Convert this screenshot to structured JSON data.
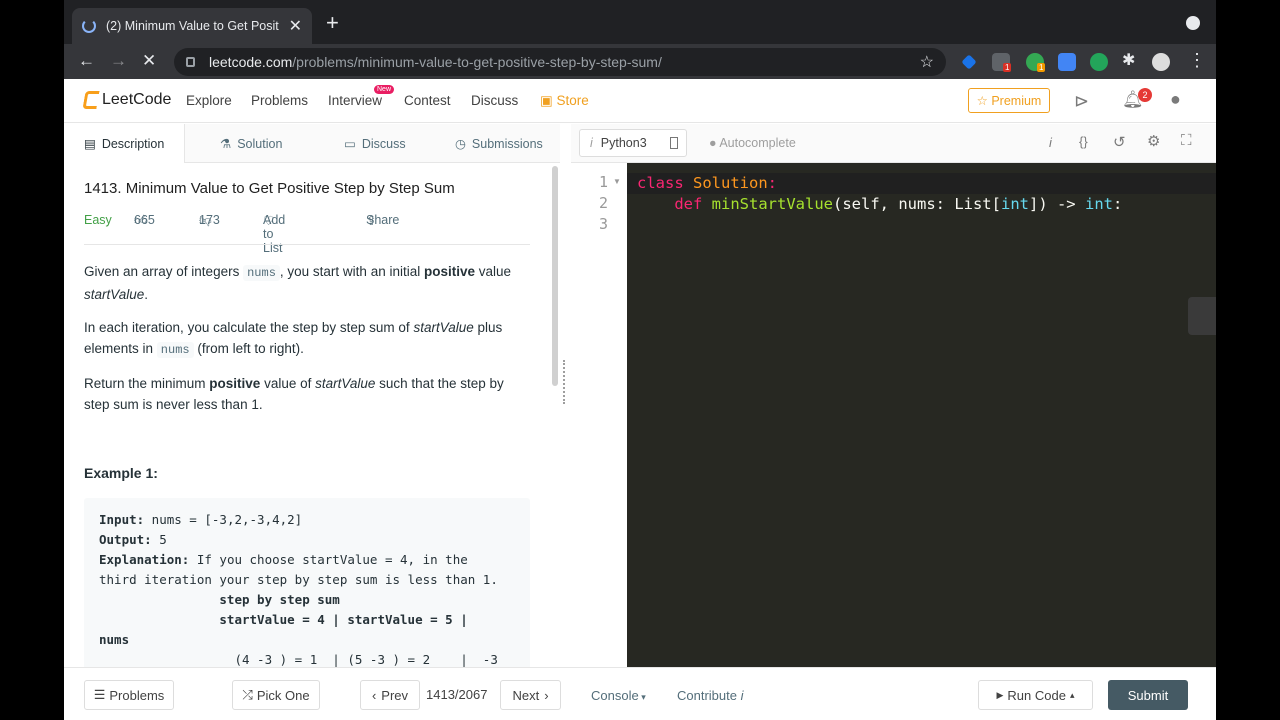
{
  "browser": {
    "tab_title": "(2) Minimum Value to Get Posit",
    "url_domain": "leetcode.com",
    "url_path": "/problems/minimum-value-to-get-positive-step-by-step-sum/",
    "ext_badge_red": "1",
    "ext_badge_orange": "1"
  },
  "nav": {
    "logo": "LeetCode",
    "explore": "Explore",
    "problems": "Problems",
    "interview": "Interview",
    "new_badge": "New",
    "contest": "Contest",
    "discuss": "Discuss",
    "store": "Store",
    "premium": "☆ Premium",
    "notif_count": "2"
  },
  "left_tabs": {
    "description": "Description",
    "solution": "Solution",
    "discuss": "Discuss",
    "submissions": "Submissions"
  },
  "problem": {
    "title": "1413. Minimum Value to Get Positive Step by Step Sum",
    "difficulty": "Easy",
    "likes": "665",
    "dislikes": "173",
    "add_to_list": "Add to List",
    "share": "Share",
    "p1a": "Given an array of integers ",
    "p1_code": "nums",
    "p1b": ", you start with an initial ",
    "p1_bold": "positive",
    "p1c": " value ",
    "p1_em": "startValue",
    "p1d": ".",
    "p2a": "In each iteration, you calculate the step by step sum of ",
    "p2_em": "startValue",
    "p2b": " plus elements in ",
    "p2_code": "nums",
    "p2c": " (from left to right).",
    "p3a": "Return the minimum ",
    "p3_bold": "positive",
    "p3b": " value of ",
    "p3_em": "startValue",
    "p3c": " such that the step by step sum is never less than 1.",
    "example_title": "Example 1:",
    "ex_input_label": "Input:",
    "ex_input": " nums = [-3,2,-3,4,2]",
    "ex_output_label": "Output:",
    "ex_output": " 5",
    "ex_expl_label": "Explanation:",
    "ex_expl": " If you choose startValue = 4, in the\nthird iteration your step by step sum is less than 1.",
    "ex_tbl_head": "                step by step sum\n                startValue = 4 | startValue = 5 |\nnums",
    "ex_row1": "                  (4 -3 ) = 1  | (5 -3 ) = 2    |  -3"
  },
  "editor": {
    "language": "Python3",
    "autocomplete": "Autocomplete",
    "lines": [
      "1",
      "2",
      "3"
    ],
    "line1_kw": "class",
    "line1_name": "Solution",
    "line1_end": ":",
    "line2_kw": "def",
    "line2_fn": "minStartValue",
    "line2_a": "(self, nums: List[",
    "line2_int": "int",
    "line2_b": "]) -> ",
    "line2_ret": "int",
    "line2_end": ":"
  },
  "bottom": {
    "problems": "Problems",
    "pick_one": "Pick One",
    "prev": "Prev",
    "page": "1413/2067",
    "next": "Next",
    "console": "Console",
    "contribute": "Contribute",
    "run_code": "Run Code",
    "submit": "Submit"
  }
}
